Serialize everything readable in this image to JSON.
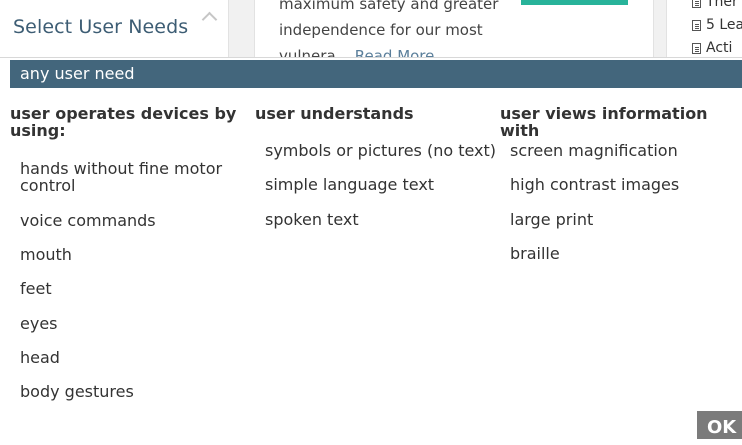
{
  "background": {
    "filter_title": "Select User Needs",
    "card_text_line1": "maximum safety and greater",
    "card_text_line2": "independence for our most",
    "card_text_line3": "vulnera...",
    "card_read_more": "Read More",
    "side_items": [
      "Ther",
      "5 Lea",
      "Acti"
    ]
  },
  "dropdown": {
    "any_option": "any user need",
    "columns": [
      {
        "heading": "user operates devices by using:",
        "options": [
          "hands without fine motor control",
          "voice commands",
          "mouth",
          "feet",
          "eyes",
          "head",
          "body gestures"
        ]
      },
      {
        "heading": "user understands",
        "options": [
          "symbols or pictures (no text)",
          "simple language text",
          "spoken text"
        ]
      },
      {
        "heading": "user views information with",
        "options": [
          "screen magnification",
          "high contrast images",
          "large print",
          "braille"
        ]
      }
    ],
    "ok_label": "OK"
  },
  "colors": {
    "selected_bg": "#43667c",
    "title_color": "#3d5d74",
    "ok_bg": "#7b7b7b"
  }
}
